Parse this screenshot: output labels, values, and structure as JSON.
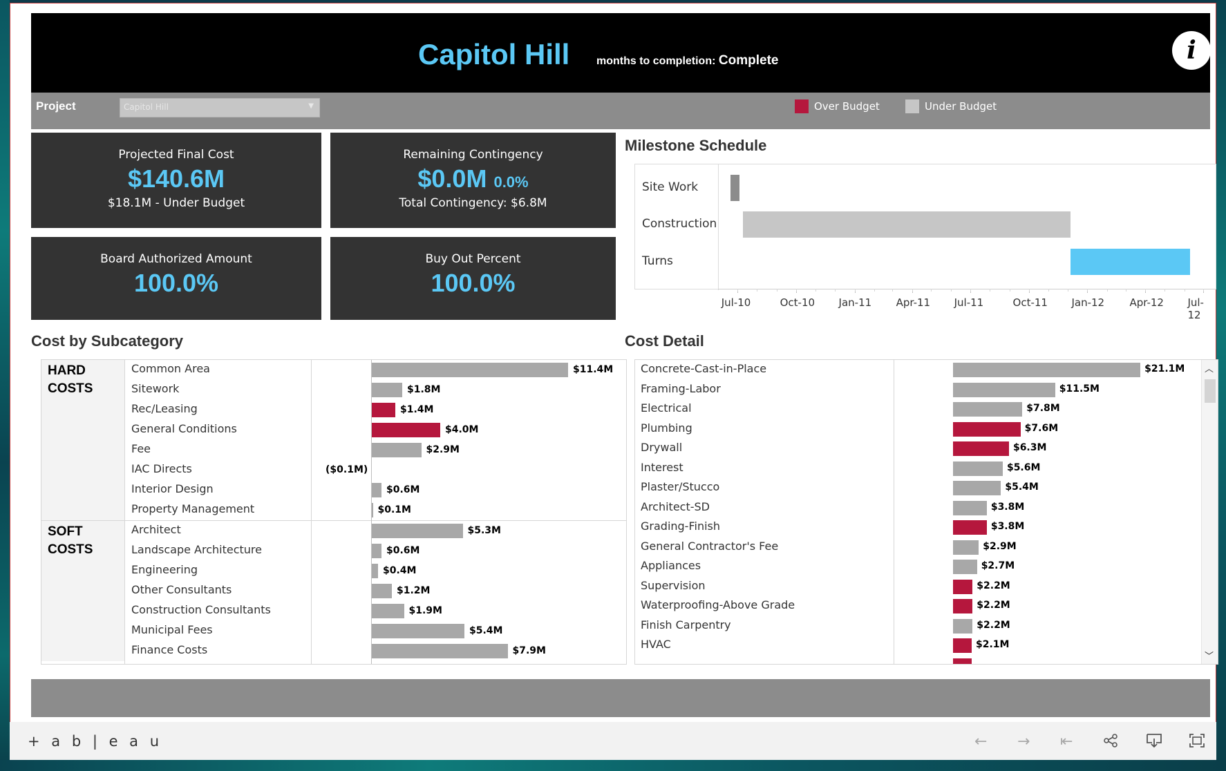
{
  "header": {
    "title": "Capitol Hill",
    "months_label": "months to completion:",
    "months_value": "Complete",
    "info_icon": "i"
  },
  "filter": {
    "project_label": "Project",
    "project_value": "Capitol Hill",
    "legend": [
      {
        "label": "Over Budget",
        "color": "#b5173d"
      },
      {
        "label": "Under Budget",
        "color": "#c6c6c6"
      }
    ]
  },
  "kpis": {
    "projected": {
      "label": "Projected Final Cost",
      "value": "$140.6M",
      "sub": "$18.1M - Under Budget"
    },
    "contingency": {
      "label": "Remaining Contingency",
      "value": "$0.0M",
      "value_small": "0.0%",
      "sub": "Total Contingency: $6.8M"
    },
    "board": {
      "label": "Board Authorized Amount",
      "value": "100.0%"
    },
    "buyout": {
      "label": "Buy Out Percent",
      "value": "100.0%"
    }
  },
  "milestone": {
    "title": "Milestone Schedule",
    "tasks": [
      {
        "name": "Site Work",
        "start": "2010-06-20",
        "end": "2010-07-05",
        "color": "#8c8c8c"
      },
      {
        "name": "Construction",
        "start": "2010-07-10",
        "end": "2011-12-05",
        "color": "#c6c6c6"
      },
      {
        "name": "Turns",
        "start": "2011-12-05",
        "end": "2012-06-10",
        "color": "#5bc8f5"
      }
    ],
    "ticks": [
      "Jul-10",
      "Oct-10",
      "Jan-11",
      "Apr-11",
      "Jul-11",
      "Oct-11",
      "Jan-12",
      "Apr-12",
      "Jul-12"
    ]
  },
  "subcategory": {
    "title": "Cost by Subcategory",
    "groups": [
      {
        "name_line1": "HARD",
        "name_line2": "COSTS",
        "rows": [
          {
            "name": "Common Area",
            "value": 11.4,
            "label": "$11.4M",
            "over": false
          },
          {
            "name": "Sitework",
            "value": 1.8,
            "label": "$1.8M",
            "over": false
          },
          {
            "name": "Rec/Leasing",
            "value": 1.4,
            "label": "$1.4M",
            "over": true
          },
          {
            "name": "General Conditions",
            "value": 4.0,
            "label": "$4.0M",
            "over": true
          },
          {
            "name": "Fee",
            "value": 2.9,
            "label": "$2.9M",
            "over": false
          },
          {
            "name": "IAC Directs",
            "value": -0.1,
            "label": "($0.1M)",
            "over": false
          },
          {
            "name": "Interior Design",
            "value": 0.6,
            "label": "$0.6M",
            "over": false
          },
          {
            "name": "Property Management",
            "value": 0.1,
            "label": "$0.1M",
            "over": false
          }
        ]
      },
      {
        "name_line1": "SOFT",
        "name_line2": "COSTS",
        "rows": [
          {
            "name": "Architect",
            "value": 5.3,
            "label": "$5.3M",
            "over": false
          },
          {
            "name": "Landscape Architecture",
            "value": 0.6,
            "label": "$0.6M",
            "over": false
          },
          {
            "name": "Engineering",
            "value": 0.4,
            "label": "$0.4M",
            "over": false
          },
          {
            "name": "Other Consultants",
            "value": 1.2,
            "label": "$1.2M",
            "over": false
          },
          {
            "name": "Construction Consultants",
            "value": 1.9,
            "label": "$1.9M",
            "over": false
          },
          {
            "name": "Municipal Fees",
            "value": 5.4,
            "label": "$5.4M",
            "over": false
          },
          {
            "name": "Finance Costs",
            "value": 7.9,
            "label": "$7.9M",
            "over": false
          }
        ]
      }
    ]
  },
  "detail": {
    "title": "Cost Detail",
    "rows": [
      {
        "name": "Concrete-Cast-in-Place",
        "value": 21.1,
        "label": "$21.1M",
        "over": false
      },
      {
        "name": "Framing-Labor",
        "value": 11.5,
        "label": "$11.5M",
        "over": false
      },
      {
        "name": "Electrical",
        "value": 7.8,
        "label": "$7.8M",
        "over": false
      },
      {
        "name": "Plumbing",
        "value": 7.6,
        "label": "$7.6M",
        "over": true
      },
      {
        "name": "Drywall",
        "value": 6.3,
        "label": "$6.3M",
        "over": true
      },
      {
        "name": "Interest",
        "value": 5.6,
        "label": "$5.6M",
        "over": false
      },
      {
        "name": "Plaster/Stucco",
        "value": 5.4,
        "label": "$5.4M",
        "over": false
      },
      {
        "name": "Architect-SD",
        "value": 3.8,
        "label": "$3.8M",
        "over": false
      },
      {
        "name": "Grading-Finish",
        "value": 3.8,
        "label": "$3.8M",
        "over": true
      },
      {
        "name": "General Contractor's Fee",
        "value": 2.9,
        "label": "$2.9M",
        "over": false
      },
      {
        "name": "Appliances",
        "value": 2.7,
        "label": "$2.7M",
        "over": false
      },
      {
        "name": "Supervision",
        "value": 2.2,
        "label": "$2.2M",
        "over": true
      },
      {
        "name": "Waterproofing-Above Grade",
        "value": 2.2,
        "label": "$2.2M",
        "over": true
      },
      {
        "name": "Finish Carpentry",
        "value": 2.2,
        "label": "$2.2M",
        "over": false
      },
      {
        "name": "HVAC",
        "value": 2.1,
        "label": "$2.1M",
        "over": true
      },
      {
        "name": "",
        "value": 2.1,
        "label": "",
        "over": true
      }
    ]
  },
  "toolbar": {
    "logo": "+ a b | e a u",
    "icons": [
      "undo-icon",
      "redo-icon",
      "revert-icon",
      "share-icon",
      "download-icon",
      "fullscreen-icon"
    ]
  },
  "colors": {
    "over": "#b5173d",
    "under": "#a8a8a8",
    "accent": "#5bc8f5"
  }
}
